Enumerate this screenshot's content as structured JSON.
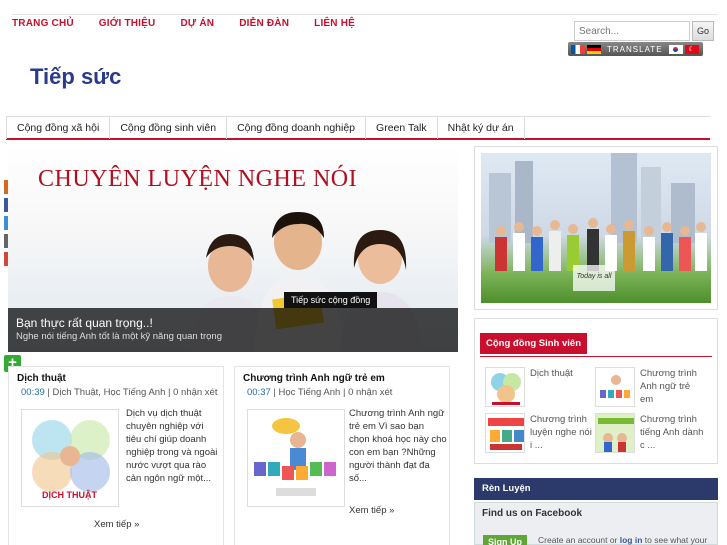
{
  "topnav": [
    "TRANG CHỦ",
    "GIỚI THIỆU",
    "DỰ ÁN",
    "DIỄN ĐÀN",
    "LIÊN HỆ"
  ],
  "search": {
    "placeholder": "Search...",
    "button": "Go"
  },
  "translate": {
    "label": "TRANSLATE"
  },
  "site": {
    "title": "Tiếp sức"
  },
  "mainmenu": [
    "Cộng đồng xã hội",
    "Cộng đồng sinh viên",
    "Cộng đồng doanh nghiệp",
    "Green Talk",
    "Nhật ký dự án"
  ],
  "slider": {
    "headline": "CHUYÊN LUYỆN NGHE NÓI",
    "tag": "Tiếp sức cộng đồng",
    "caption_title": "Bạn thực rất quan trọng..!",
    "caption_text": "Nghe nói tiếng Anh tốt là một kỹ năng quan trọng"
  },
  "posts": [
    {
      "title": "Dịch thuật",
      "time": "00:39",
      "meta": " | Dịch Thuật, Học Tiếng Anh | 0 nhận xét",
      "thumb_label": "DỊCH THUẬT",
      "excerpt": "Dịch vụ dịch thuật chuyên nghiệp với tiêu chí giúp doanh nghiệp trong và ngoài nước vượt qua rào cản ngôn ngữ một...",
      "more": "Xem tiếp »"
    },
    {
      "title": "Chương trình Anh ngữ trẻ em",
      "time": "00:37",
      "meta": " | Học Tiếng Anh | 0 nhận xét",
      "excerpt": "Chương trình Anh ngữ trẻ em Vì sao bạn chọn khoá học này cho con em bạn ?Những người thành đạt đa số...",
      "more": "Xem tiếp »"
    }
  ],
  "side": {
    "photo_caption": "Today is all",
    "box_title": "Cộng đồng Sinh viên",
    "items": [
      "Dịch thuật",
      "Chương trình Anh ngữ trẻ em",
      "Chương trình luyện nghe nói i ...",
      "Chương trình tiếng Anh dành c ..."
    ],
    "ren": "Rèn Luyện",
    "fb_title": "Find us on Facebook",
    "fb_signup": "Sign Up",
    "fb_msg_a": "Create an account or ",
    "fb_msg_b": "log in",
    "fb_msg_c": " to see what your"
  },
  "colors": {
    "accent": "#c8102e",
    "title": "#2a3a8c",
    "dark_bar": "#2b3a6b"
  },
  "icons": [
    "plus-icon",
    "flag-fr-icon",
    "flag-de-icon",
    "flag-kr-icon",
    "flag-tr-icon"
  ]
}
